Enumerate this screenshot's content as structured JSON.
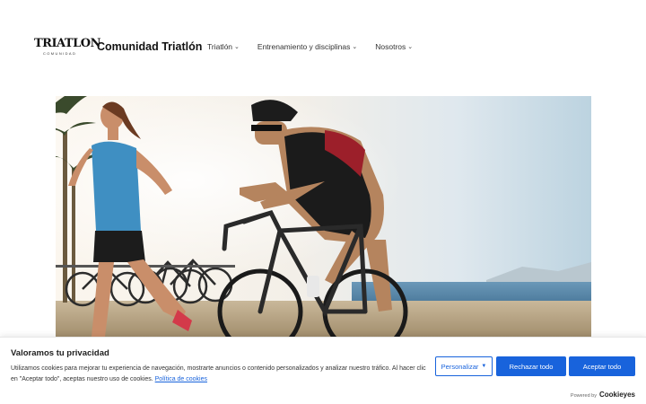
{
  "header": {
    "logo_text": "TRIATLON",
    "logo_sub": "COMUNIDAD",
    "site_title": "Comunidad Triatlón",
    "nav": [
      {
        "label": "Triatlón"
      },
      {
        "label": "Entrenamiento y disciplinas"
      },
      {
        "label": "Nosotros"
      }
    ]
  },
  "hero": {
    "alt": "Corredora y ciclista de triatlón junto al mar"
  },
  "cookie_banner": {
    "title": "Valoramos tu privacidad",
    "text": "Utilizamos cookies para mejorar tu experiencia de navegación, mostrarte anuncios o contenido personalizados y analizar nuestro tráfico. Al hacer clic en \"Aceptar todo\", aceptas nuestro uso de cookies.",
    "policy_link": "Política de cookies",
    "customize_label": "Personalizar",
    "reject_label": "Rechazar todo",
    "accept_label": "Aceptar todo",
    "powered_by": "Powered by",
    "brand": "Cookieyes"
  },
  "colors": {
    "accent": "#1863dc"
  }
}
